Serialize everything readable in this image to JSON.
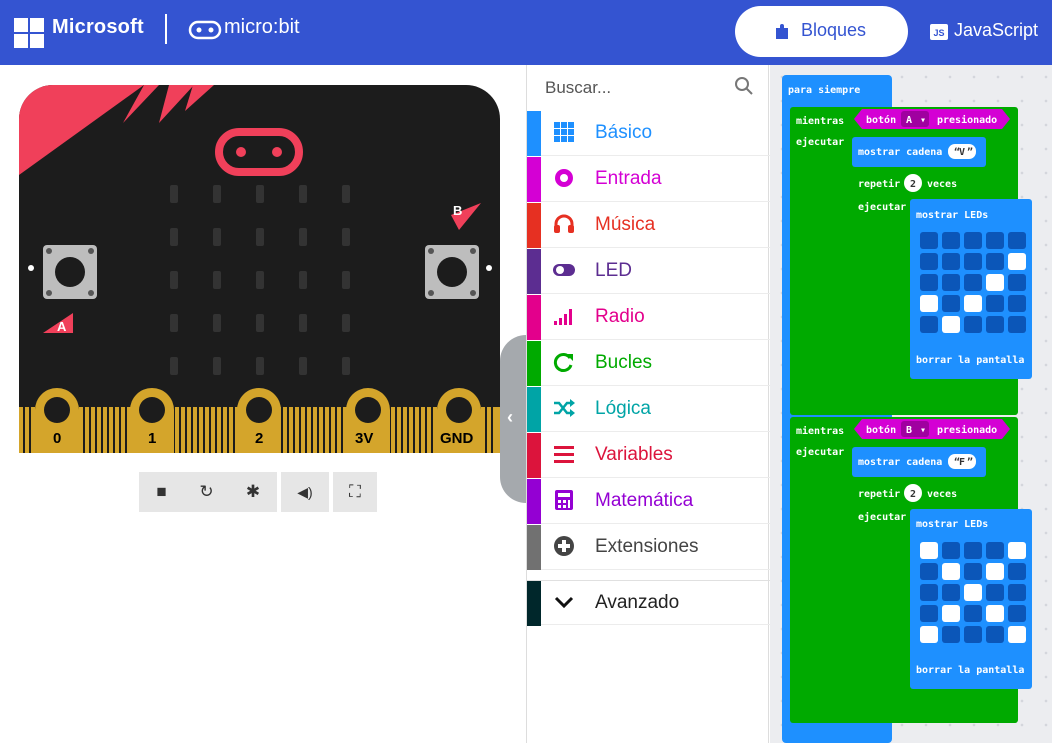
{
  "header": {
    "brand": "Microsoft",
    "product": "micro:bit",
    "tabs": [
      {
        "label": "Bloques",
        "icon": "puzzle-icon",
        "active": true
      },
      {
        "label": "JavaScript",
        "icon": "js-icon",
        "badge": "JS",
        "active": false
      }
    ],
    "color": "#3454d1"
  },
  "simulator": {
    "buttons": {
      "a": "A",
      "b": "B"
    },
    "pins": [
      "0",
      "1",
      "2",
      "3V",
      "GND"
    ],
    "controls": [
      "stop-icon",
      "restart-icon",
      "debug-icon",
      "audio-icon",
      "fullscreen-icon"
    ]
  },
  "toolbox": {
    "search_placeholder": "Buscar...",
    "categories": [
      {
        "label": "Básico",
        "color": "#1e90ff",
        "icon": "grid-icon"
      },
      {
        "label": "Entrada",
        "color": "#d400d4",
        "icon": "circle-icon"
      },
      {
        "label": "Música",
        "color": "#e63022",
        "icon": "headphones-icon"
      },
      {
        "label": "LED",
        "color": "#5c2d91",
        "icon": "toggle-icon"
      },
      {
        "label": "Radio",
        "color": "#e3008c",
        "icon": "signal-icon"
      },
      {
        "label": "Bucles",
        "color": "#00aa00",
        "icon": "loop-icon"
      },
      {
        "label": "Lógica",
        "color": "#00a4a6",
        "icon": "shuffle-icon"
      },
      {
        "label": "Variables",
        "color": "#dc143c",
        "icon": "lines-icon"
      },
      {
        "label": "Matemática",
        "color": "#9400d3",
        "icon": "calculator-icon"
      },
      {
        "label": "Extensiones",
        "color": "#717171",
        "icon": "plus-icon"
      },
      {
        "label": "Avanzado",
        "color": "#00272b",
        "icon": "chevron-down-icon"
      }
    ]
  },
  "workspace": {
    "forever_label": "para siempre",
    "while_label": "mientras",
    "do_label": "ejecutar",
    "button_label": "botón",
    "pressed_label": "presionado",
    "show_string_label": "mostrar cadena",
    "repeat_label": "repetir",
    "times_label": "veces",
    "show_leds_label": "mostrar LEDs",
    "clear_label": "borrar la pantalla",
    "loop1": {
      "button": "A",
      "string": "V",
      "times": "2"
    },
    "loop2": {
      "button": "B",
      "string": "F",
      "times": "2"
    },
    "leds1": [
      [
        0,
        0,
        0,
        0,
        0
      ],
      [
        0,
        0,
        0,
        0,
        1
      ],
      [
        0,
        0,
        0,
        1,
        0
      ],
      [
        1,
        0,
        1,
        0,
        0
      ],
      [
        0,
        1,
        0,
        0,
        0
      ]
    ],
    "leds2": [
      [
        1,
        0,
        0,
        0,
        1
      ],
      [
        0,
        1,
        0,
        1,
        0
      ],
      [
        0,
        0,
        1,
        0,
        0
      ],
      [
        0,
        1,
        0,
        1,
        0
      ],
      [
        1,
        0,
        0,
        0,
        1
      ]
    ],
    "colors": {
      "basic": "#1e90ff",
      "loops": "#00aa00",
      "input": "#d400d4"
    }
  }
}
